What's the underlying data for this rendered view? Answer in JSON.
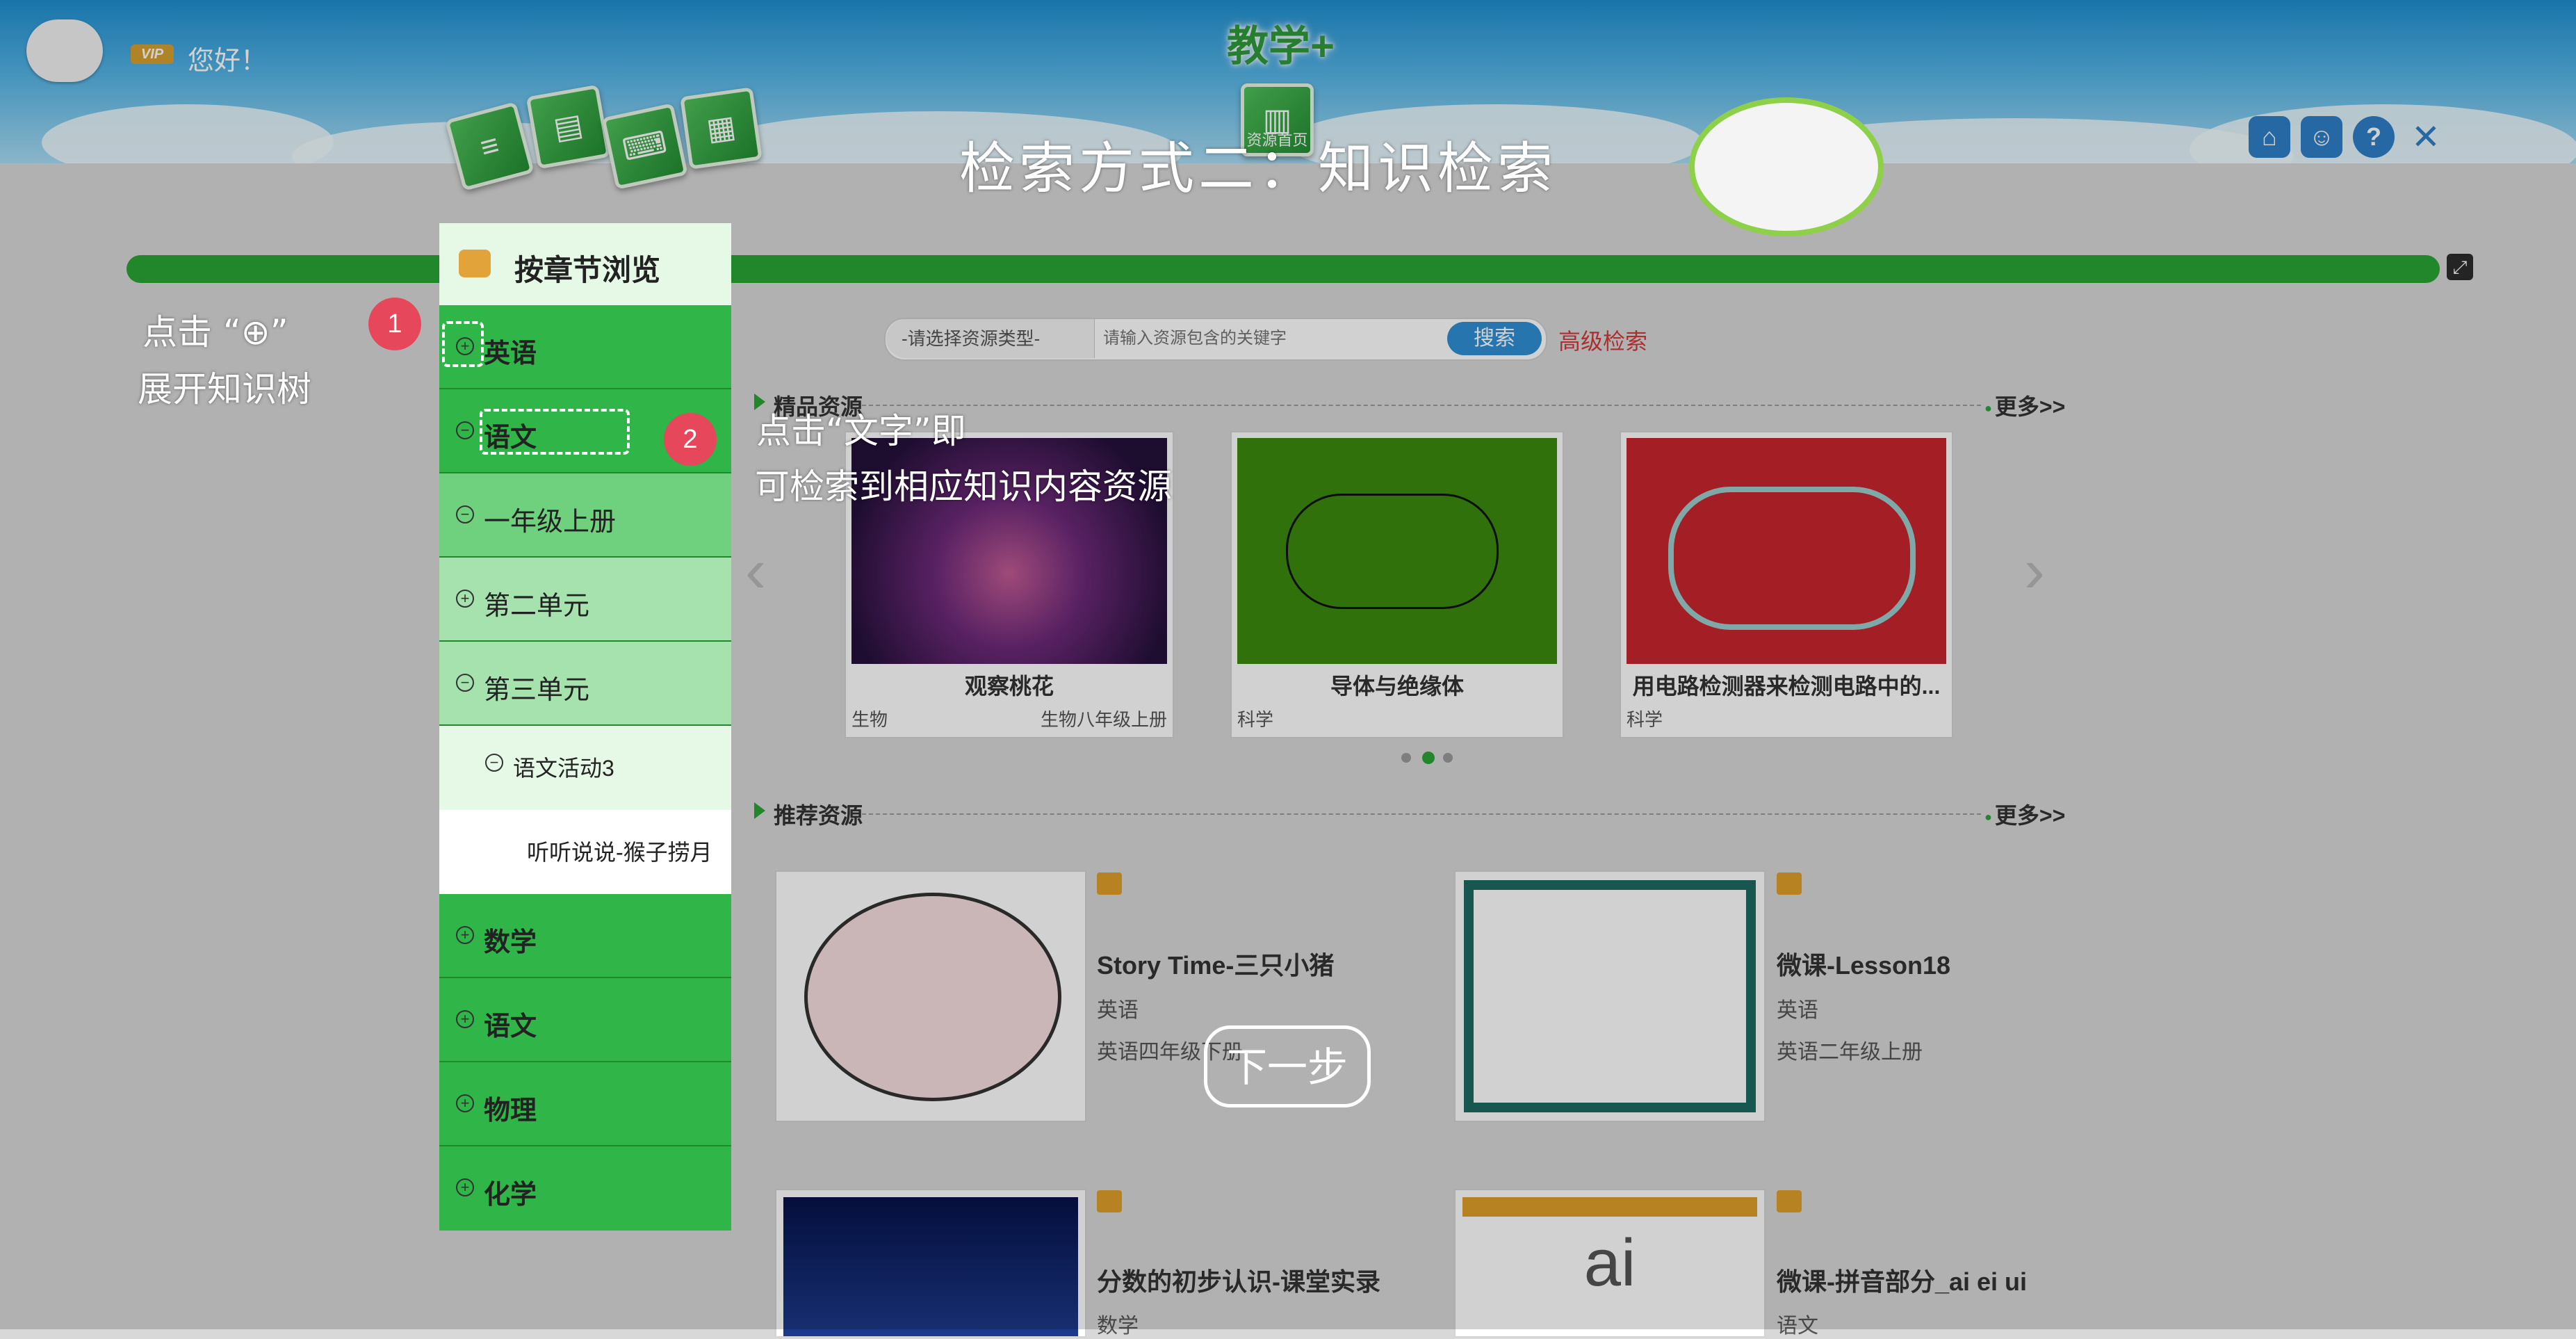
{
  "header": {
    "app_title": "教学+",
    "vip_label": "VIP",
    "greeting": "您好！",
    "tile_labels": [
      "资源首页"
    ],
    "top_icons": [
      "home-icon",
      "user-icon",
      "help-icon",
      "close-icon"
    ]
  },
  "search": {
    "resource_type_placeholder": "-请选择资源类型-",
    "keyword_placeholder": "请输入资源包含的关键字",
    "search_label": "搜索",
    "advanced_label": "高级检索"
  },
  "featured": {
    "title": "精品资源",
    "more_label": "更多>>",
    "cards": [
      {
        "title": "观察桃花",
        "subject": "生物",
        "grade": "生物八年级上册"
      },
      {
        "title": "导体与绝缘体",
        "subject": "科学",
        "grade": ""
      },
      {
        "title": "用电路检测器来检测电路中的...",
        "subject": "科学",
        "grade": ""
      }
    ]
  },
  "recommended": {
    "title": "推荐资源",
    "more_label": "更多>>",
    "items": [
      {
        "title": "Story Time-三只小猪",
        "subject": "英语",
        "grade": "英语四年级下册"
      },
      {
        "title": "微课-Lesson18",
        "subject": "英语",
        "grade": "英语二年级上册"
      },
      {
        "title": "分数的初步认识-课堂实录",
        "subject": "数学",
        "grade": ""
      },
      {
        "title": "微课-拼音部分_ai ei ui",
        "subject": "语文",
        "grade": ""
      }
    ],
    "thumb_texts": [
      "ai"
    ]
  },
  "tree": {
    "header_label": "按章节浏览",
    "items": [
      {
        "symbol": "+",
        "label": "英语",
        "bold": true
      },
      {
        "symbol": "−",
        "label": "语文",
        "bold": true
      },
      {
        "symbol": "−",
        "label": "一年级上册",
        "bold": false
      },
      {
        "symbol": "+",
        "label": "第二单元",
        "bold": false
      },
      {
        "symbol": "−",
        "label": "第三单元",
        "bold": false
      },
      {
        "symbol": "−",
        "label": "语文活动3",
        "bold": false
      },
      {
        "symbol": "",
        "label": "听听说说-猴子捞月",
        "bold": false
      },
      {
        "symbol": "+",
        "label": "数学",
        "bold": true
      },
      {
        "symbol": "+",
        "label": "语文",
        "bold": true
      },
      {
        "symbol": "+",
        "label": "物理",
        "bold": true
      },
      {
        "symbol": "+",
        "label": "化学",
        "bold": true
      }
    ]
  },
  "tutorial": {
    "heading": "检索方式二：知识检索",
    "step1_line1": "点击 “⊕”",
    "step1_line2": "展开知识树",
    "step2_line1": "点击“文字”即",
    "step2_line2": "可检索到相应知识内容资源",
    "badge1": "1",
    "badge2": "2",
    "next_label": "下一步"
  },
  "colors": {
    "accent_green": "#2aa535",
    "badge_red": "#e6475b",
    "link_red": "#d23a3a",
    "button_blue": "#2f8fd6"
  }
}
